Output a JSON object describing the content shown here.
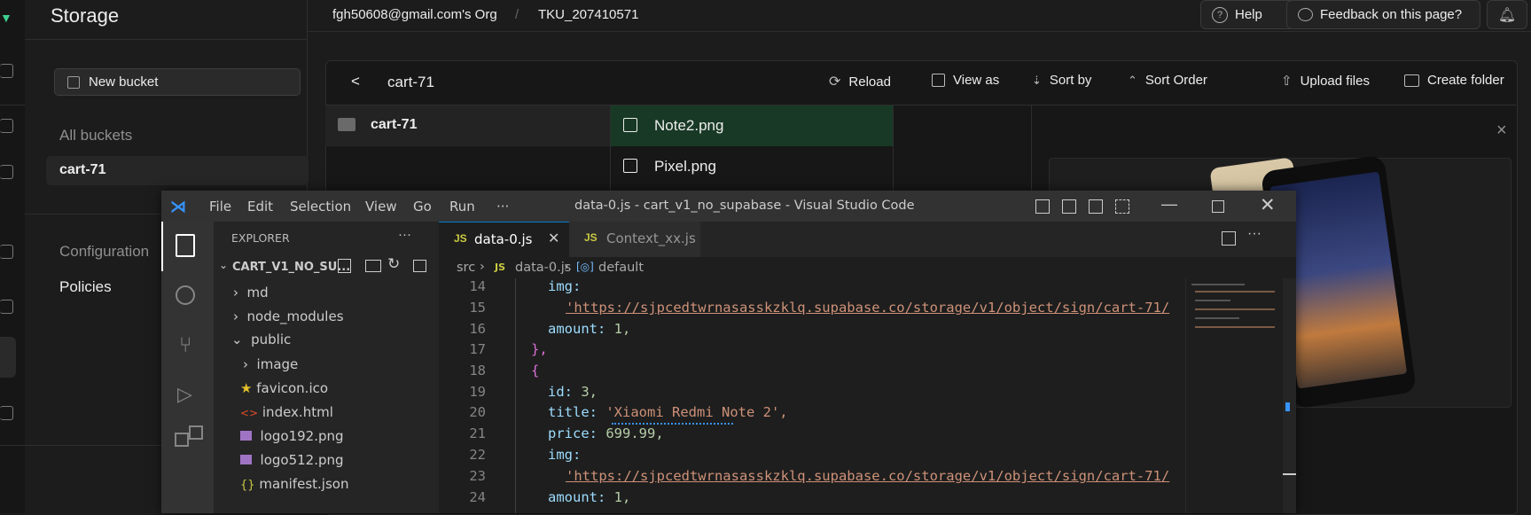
{
  "supabase": {
    "title": "Storage",
    "org": "fgh50608@gmail.com's Org",
    "separator": "/",
    "project": "TKU_207410571",
    "help": "Help",
    "feedback": "Feedback on this page?",
    "new_bucket": "New bucket",
    "all_buckets": "All buckets",
    "bucket": "cart-71",
    "configuration": "Configuration",
    "policies": "Policies",
    "toolbar": {
      "back": "<",
      "path": "cart-71",
      "reload": "Reload",
      "view_as": "View as",
      "sort_by": "Sort by",
      "sort_order": "Sort Order",
      "upload": "Upload files",
      "create_folder": "Create folder"
    },
    "column_folder": "cart-71",
    "files": [
      "Note2.png",
      "Pixel.png"
    ],
    "close": "×"
  },
  "vscode": {
    "menus": [
      "File",
      "Edit",
      "Selection",
      "View",
      "Go",
      "Run",
      "···"
    ],
    "title": "data-0.js - cart_v1_no_supabase - Visual Studio Code",
    "explorer_title": "EXPLORER",
    "project_folder": "CART_V1_NO_SU...",
    "tree": [
      "md",
      "node_modules",
      "public",
      "image",
      "favicon.ico",
      "index.html",
      "logo192.png",
      "logo512.png",
      "manifest.json"
    ],
    "tabs": [
      {
        "label": "data-0.js",
        "icon": "JS"
      },
      {
        "label": "Context_xx.js",
        "icon": "JS"
      }
    ],
    "breadcrumb": {
      "src": "src",
      "file": "data-0.js",
      "symbol": "default"
    },
    "line_numbers": [
      "14",
      "15",
      "16",
      "17",
      "18",
      "19",
      "20",
      "21",
      "22",
      "23",
      "24"
    ],
    "code": {
      "l14": "img:",
      "l15": "'https://sjpcedtwrnasasskzklq.supabase.co/storage/v1/object/sign/cart-71/",
      "l16_k": "amount:",
      "l16_v": "1,",
      "l17": "},",
      "l18": "{",
      "l19_k": "id:",
      "l19_v": "3,",
      "l20_k": "title:",
      "l20_v": "'Xiaomi Redmi Note 2',",
      "l21_k": "price:",
      "l21_v": "699.99,",
      "l22": "img:",
      "l23": "'https://sjpcedtwrnasasskzklq.supabase.co/storage/v1/object/sign/cart-71/",
      "l24_k": "amount:",
      "l24_v": "1,"
    }
  },
  "colors": {
    "supabase_bg": "#1c1c1c",
    "selected_file": "#183925",
    "vscode_accent": "#007acc",
    "js_yellow": "#cbcb41"
  }
}
